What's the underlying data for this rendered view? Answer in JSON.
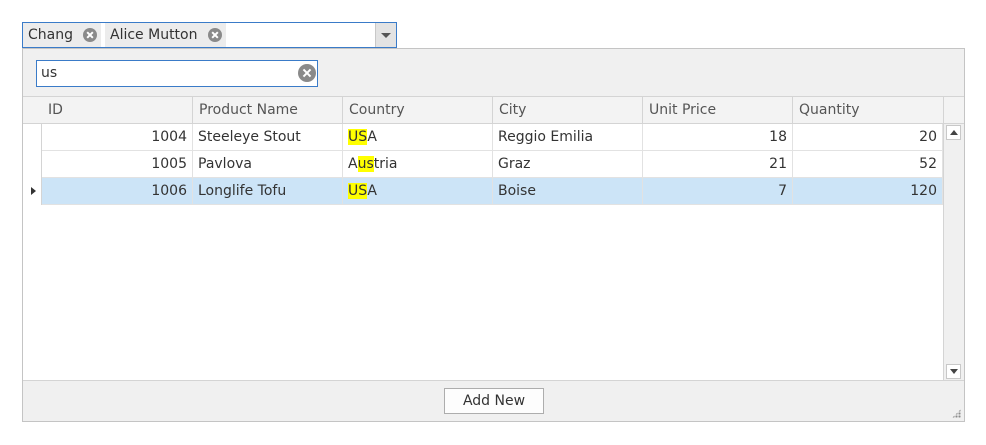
{
  "combo": {
    "tokens": [
      {
        "label": "Chang"
      },
      {
        "label": "Alice Mutton"
      }
    ]
  },
  "search": {
    "value": "us"
  },
  "grid": {
    "columns": [
      "ID",
      "Product Name",
      "Country",
      "City",
      "Unit Price",
      "Quantity"
    ],
    "rows": [
      {
        "id": "1004",
        "product": "Steeleye Stout",
        "country_pre": "",
        "country_hl": "US",
        "country_post": "A",
        "city": "Reggio Emilia",
        "price": "18",
        "qty": "20",
        "selected": false
      },
      {
        "id": "1005",
        "product": "Pavlova",
        "country_pre": "A",
        "country_hl": "us",
        "country_post": "tria",
        "city": "Graz",
        "price": "21",
        "qty": "52",
        "selected": false
      },
      {
        "id": "1006",
        "product": "Longlife Tofu",
        "country_pre": "",
        "country_hl": "US",
        "country_post": "A",
        "city": "Boise",
        "price": "7",
        "qty": "120",
        "selected": true
      }
    ]
  },
  "footer": {
    "add_new_label": "Add New"
  },
  "colors": {
    "accent_border": "#3a7bc8",
    "selection": "#cce4f7",
    "highlight": "#ffff00"
  }
}
